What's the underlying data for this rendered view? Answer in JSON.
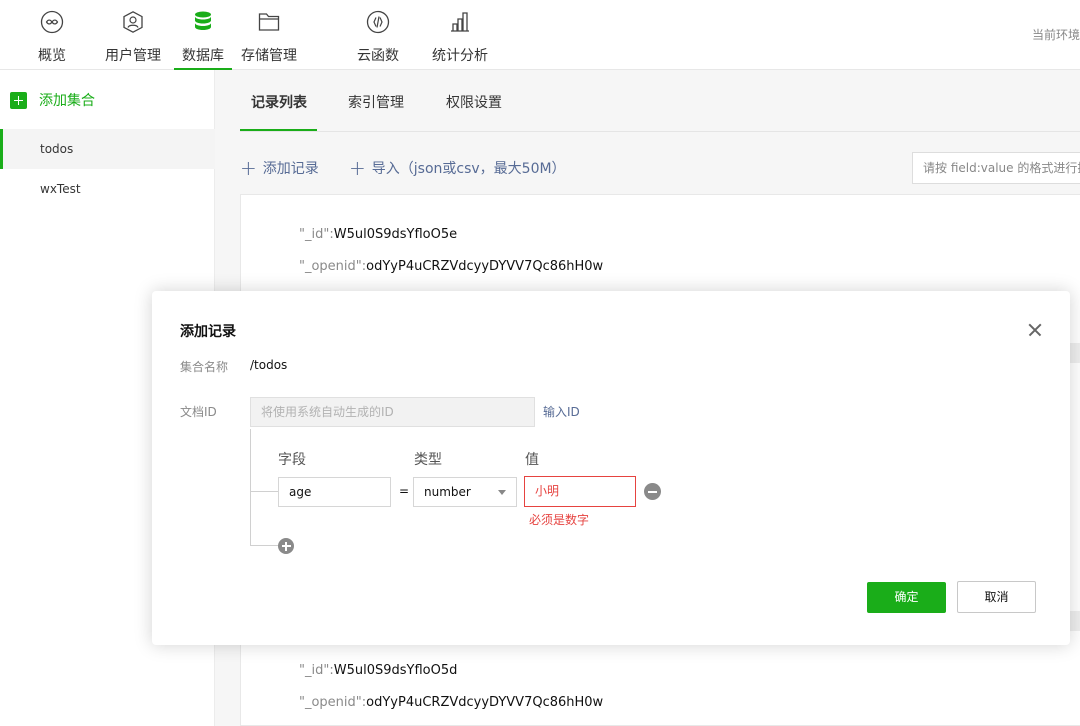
{
  "topnav": {
    "items": [
      {
        "label": "概览",
        "icon": "overview-icon"
      },
      {
        "label": "用户管理",
        "icon": "user-management-icon"
      },
      {
        "label": "数据库",
        "icon": "database-icon"
      },
      {
        "label": "存储管理",
        "icon": "storage-folder-icon"
      },
      {
        "label": "云函数",
        "icon": "cloud-function-icon"
      },
      {
        "label": "统计分析",
        "icon": "statistics-icon"
      }
    ],
    "active_index": 2,
    "environment_label": "当前环境"
  },
  "sidebar": {
    "add_collection_label": "添加集合",
    "collections": [
      "todos",
      "wxTest"
    ],
    "active_collection": "todos"
  },
  "main": {
    "tabs": [
      "记录列表",
      "索引管理",
      "权限设置"
    ],
    "active_tab": "记录列表",
    "add_record_label": "添加记录",
    "import_label": "导入（json或csv，最大50M）",
    "search_placeholder": "请按 field:value 的格式进行搜索",
    "records": [
      {
        "id_key": "\"_id\"",
        "id_value": "W5ul0S9dsYfloO5e",
        "openid_key": "\"_openid\"",
        "openid_value": "odYyP4uCRZVdcyyDYVV7Qc86hH0w"
      },
      {
        "id_key": "\"_id\"",
        "id_value": "W5ul0S9dsYfloO5d",
        "openid_key": "\"_openid\"",
        "openid_value": "odYyP4uCRZVdcyyDYVV7Qc86hH0w"
      }
    ]
  },
  "modal": {
    "title": "添加记录",
    "collection_name_label": "集合名称",
    "collection_name_value": "/todos",
    "doc_id_label": "文档ID",
    "doc_id_placeholder": "将使用系统自动生成的ID",
    "enter_id_link": "输入ID",
    "column_field": "字段",
    "column_type": "类型",
    "column_value": "值",
    "field_value": "age",
    "equals": "=",
    "type_value": "number",
    "value_value": "小明",
    "error_message": "必须是数字",
    "confirm_label": "确定",
    "cancel_label": "取消"
  },
  "colors": {
    "brand_green": "#1aad19",
    "link_blue": "#576b95",
    "error_red": "#e64340"
  }
}
